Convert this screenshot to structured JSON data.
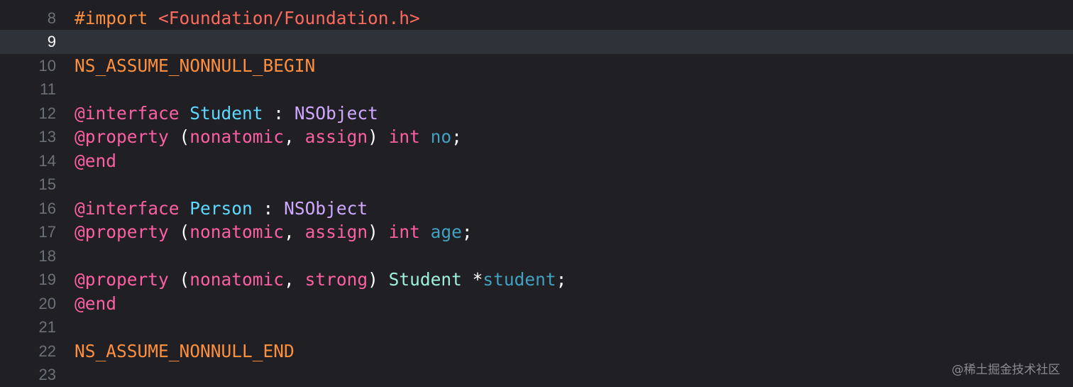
{
  "editor": {
    "current_line": "9",
    "lines": [
      {
        "num": "8",
        "tokens": [
          {
            "t": "#import",
            "c": "preproc"
          },
          {
            "t": " ",
            "c": "plain"
          },
          {
            "t": "<Foundation/Foundation.h>",
            "c": "string"
          }
        ]
      },
      {
        "num": "9",
        "tokens": []
      },
      {
        "num": "10",
        "tokens": [
          {
            "t": "NS_ASSUME_NONNULL_BEGIN",
            "c": "macro"
          }
        ]
      },
      {
        "num": "11",
        "tokens": []
      },
      {
        "num": "12",
        "tokens": [
          {
            "t": "@interface",
            "c": "keyword"
          },
          {
            "t": " ",
            "c": "plain"
          },
          {
            "t": "Student",
            "c": "decltype"
          },
          {
            "t": " : ",
            "c": "plain"
          },
          {
            "t": "NSObject",
            "c": "type"
          }
        ]
      },
      {
        "num": "13",
        "tokens": [
          {
            "t": "@property",
            "c": "keyword"
          },
          {
            "t": " (",
            "c": "plain"
          },
          {
            "t": "nonatomic",
            "c": "keyword"
          },
          {
            "t": ", ",
            "c": "plain"
          },
          {
            "t": "assign",
            "c": "keyword"
          },
          {
            "t": ") ",
            "c": "plain"
          },
          {
            "t": "int",
            "c": "keyword"
          },
          {
            "t": " ",
            "c": "plain"
          },
          {
            "t": "no",
            "c": "ident"
          },
          {
            "t": ";",
            "c": "plain"
          }
        ]
      },
      {
        "num": "14",
        "tokens": [
          {
            "t": "@end",
            "c": "keyword"
          }
        ]
      },
      {
        "num": "15",
        "tokens": []
      },
      {
        "num": "16",
        "tokens": [
          {
            "t": "@interface",
            "c": "keyword"
          },
          {
            "t": " ",
            "c": "plain"
          },
          {
            "t": "Person",
            "c": "decltype"
          },
          {
            "t": " : ",
            "c": "plain"
          },
          {
            "t": "NSObject",
            "c": "type"
          }
        ]
      },
      {
        "num": "17",
        "tokens": [
          {
            "t": "@property",
            "c": "keyword"
          },
          {
            "t": " (",
            "c": "plain"
          },
          {
            "t": "nonatomic",
            "c": "keyword"
          },
          {
            "t": ", ",
            "c": "plain"
          },
          {
            "t": "assign",
            "c": "keyword"
          },
          {
            "t": ") ",
            "c": "plain"
          },
          {
            "t": "int",
            "c": "keyword"
          },
          {
            "t": " ",
            "c": "plain"
          },
          {
            "t": "age",
            "c": "ident"
          },
          {
            "t": ";",
            "c": "plain"
          }
        ]
      },
      {
        "num": "18",
        "tokens": []
      },
      {
        "num": "19",
        "tokens": [
          {
            "t": "@property",
            "c": "keyword"
          },
          {
            "t": " (",
            "c": "plain"
          },
          {
            "t": "nonatomic",
            "c": "keyword"
          },
          {
            "t": ", ",
            "c": "plain"
          },
          {
            "t": "strong",
            "c": "keyword"
          },
          {
            "t": ") ",
            "c": "plain"
          },
          {
            "t": "Student",
            "c": "typeref"
          },
          {
            "t": " *",
            "c": "plain"
          },
          {
            "t": "student",
            "c": "ident"
          },
          {
            "t": ";",
            "c": "plain"
          }
        ]
      },
      {
        "num": "20",
        "tokens": [
          {
            "t": "@end",
            "c": "keyword"
          }
        ]
      },
      {
        "num": "21",
        "tokens": []
      },
      {
        "num": "22",
        "tokens": [
          {
            "t": "NS_ASSUME_NONNULL_END",
            "c": "macro"
          }
        ]
      },
      {
        "num": "23",
        "tokens": []
      }
    ]
  },
  "colors": {
    "background": "#1f1f24",
    "current_line_highlight": "#2f3239",
    "keyword": "#fc5fa3",
    "preprocessor": "#fd8f3f",
    "string": "#fc6a5d",
    "declared_type": "#5dd8ff",
    "system_type": "#d0a8ff",
    "type_reference": "#9ef1dd",
    "identifier": "#41a1c0",
    "line_number": "#6c7079"
  },
  "watermark": {
    "text": "@稀土掘金技术社区"
  }
}
